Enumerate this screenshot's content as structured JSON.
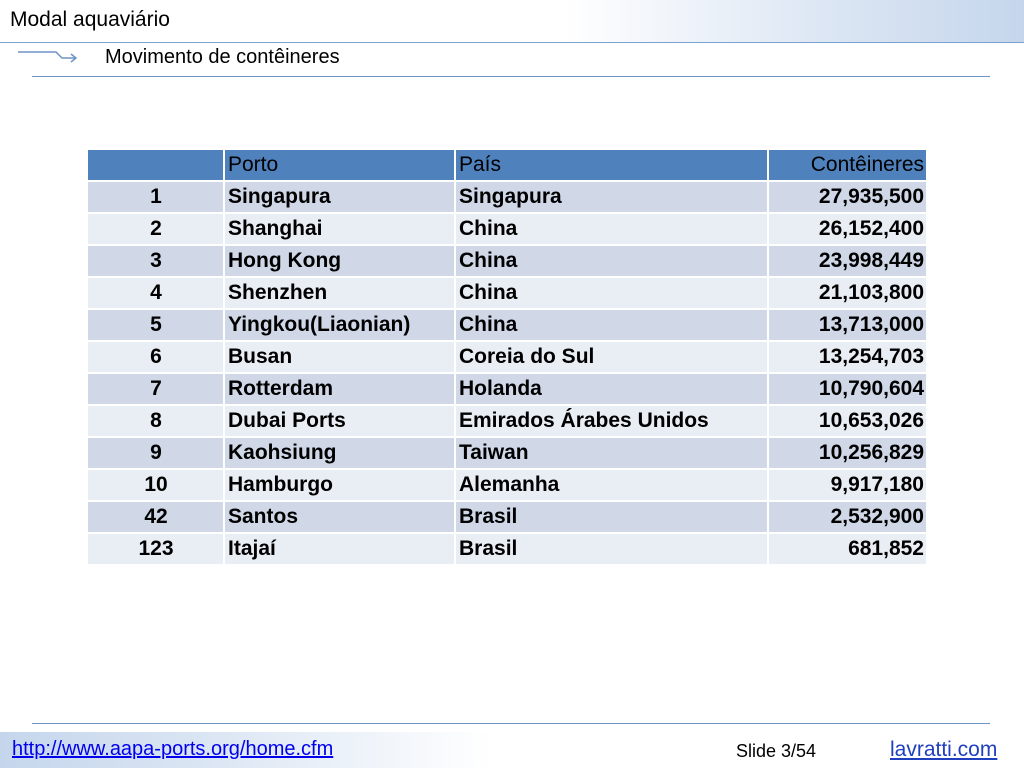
{
  "slide": {
    "title": "Modal aquaviário",
    "subtitle": "Movimento de contêineres"
  },
  "table": {
    "headers": [
      "",
      "Porto",
      "País",
      "Contêineres"
    ],
    "rows": [
      {
        "rank": "1",
        "port": "Singapura",
        "country": "Singapura",
        "containers": "27,935,500"
      },
      {
        "rank": "2",
        "port": "Shanghai",
        "country": "China",
        "containers": "26,152,400"
      },
      {
        "rank": "3",
        "port": "Hong Kong",
        "country": "China",
        "containers": "23,998,449"
      },
      {
        "rank": "4",
        "port": "Shenzhen",
        "country": "China",
        "containers": "21,103,800"
      },
      {
        "rank": "5",
        "port": "Yingkou(Liaonian)",
        "country": "China",
        "containers": "13,713,000"
      },
      {
        "rank": "6",
        "port": "Busan",
        "country": "Coreia do Sul",
        "containers": "13,254,703"
      },
      {
        "rank": "7",
        "port": "Rotterdam",
        "country": "Holanda",
        "containers": "10,790,604"
      },
      {
        "rank": "8",
        "port": "Dubai Ports",
        "country": "Emirados Árabes Unidos",
        "containers": "10,653,026"
      },
      {
        "rank": "9",
        "port": "Kaohsiung",
        "country": "Taiwan",
        "containers": "10,256,829"
      },
      {
        "rank": "10",
        "port": "Hamburgo",
        "country": "Alemanha",
        "containers": "9,917,180"
      },
      {
        "rank": "42",
        "port": "Santos",
        "country": "Brasil",
        "containers": "2,532,900"
      },
      {
        "rank": "123",
        "port": "Itajaí",
        "country": "Brasil",
        "containers": "681,852"
      }
    ]
  },
  "footer": {
    "source_link": "http://www.aapa-ports.org/home.cfm",
    "slide_counter": "Slide 3/54",
    "site_link": "lavratti.com"
  },
  "icons": {
    "subtitle_marker": "arrow-right-icon"
  },
  "colors": {
    "header_fill": "#4f81bd",
    "row_odd": "#d0d8e8",
    "row_even": "#e9edf4",
    "accent_rule": "#6f93c7"
  }
}
